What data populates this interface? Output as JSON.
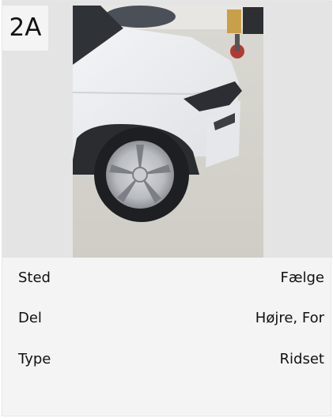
{
  "badge": "2A",
  "details": [
    {
      "label": "Sted",
      "value": "Fælge"
    },
    {
      "label": "Del",
      "value": "Højre, For"
    },
    {
      "label": "Type",
      "value": "Ridset"
    }
  ]
}
